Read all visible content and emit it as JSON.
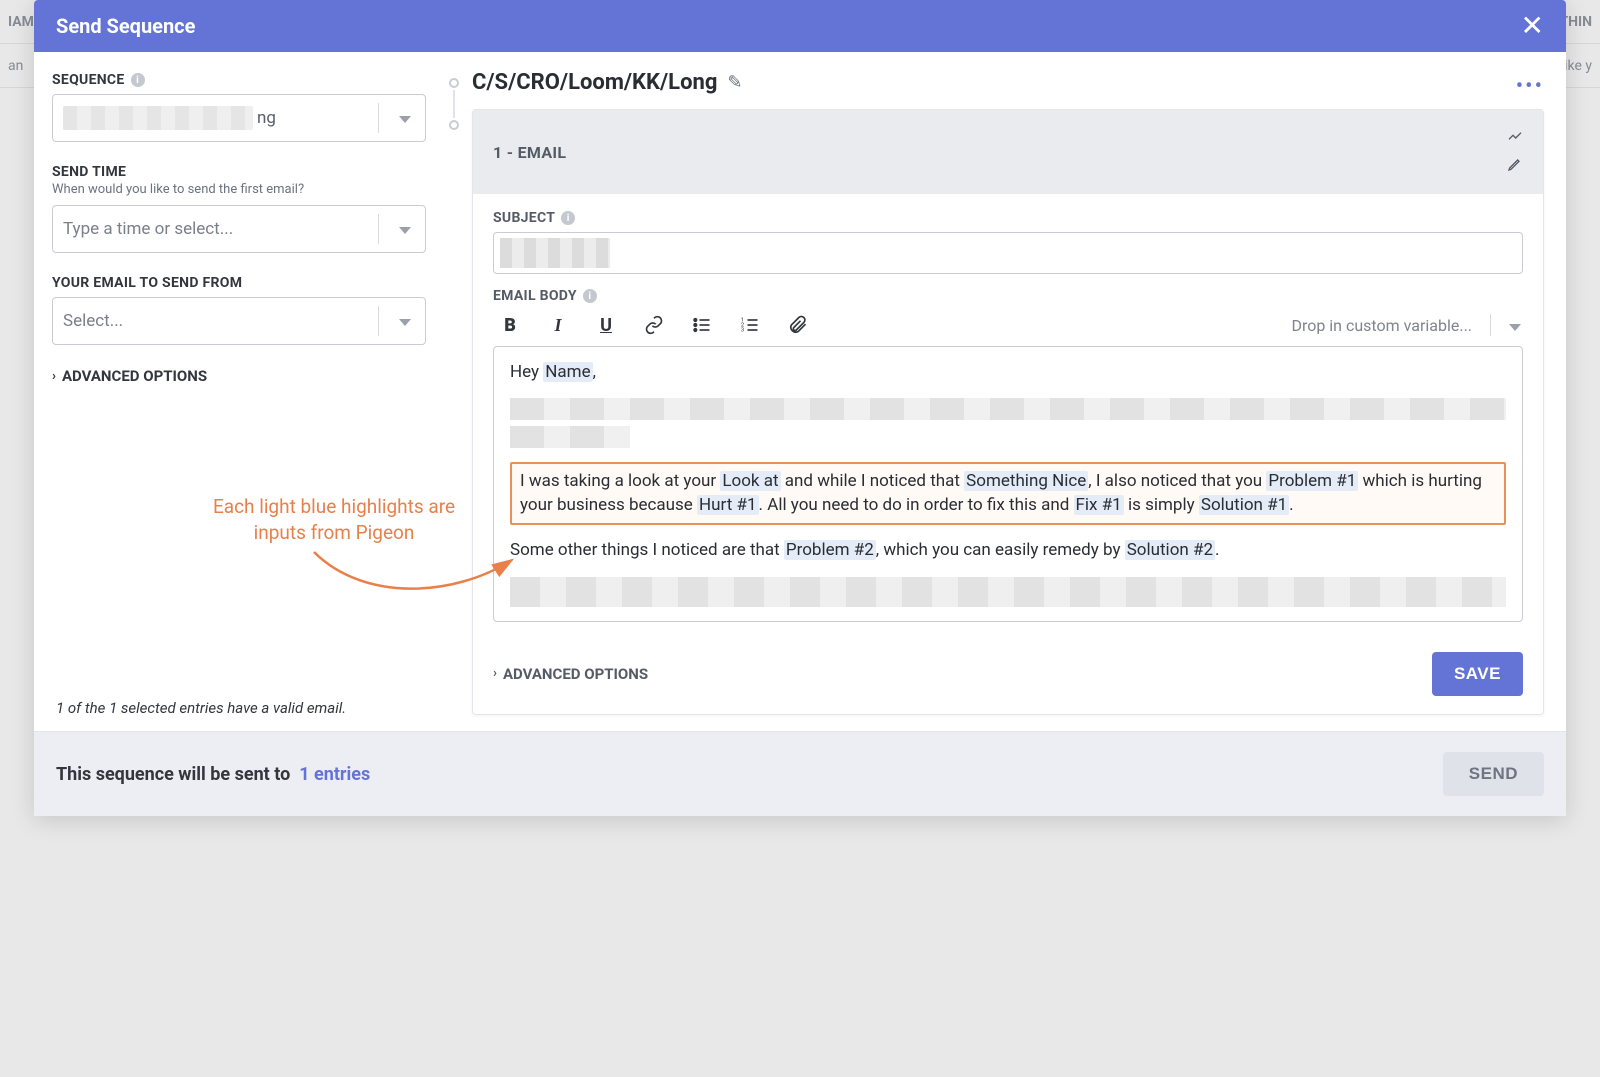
{
  "bg": {
    "col1": "IAME",
    "col2": "ETHIN",
    "row1_left": "an",
    "row1_right": "ike y"
  },
  "modal": {
    "title": "Send Sequence",
    "footer_prefix": "This sequence will be sent to",
    "footer_entries": "1 entries",
    "send": "SEND"
  },
  "left": {
    "sequence_label": "SEQUENCE",
    "sequence_value_suffix": "ng",
    "sendtime_label": "SEND TIME",
    "sendtime_sub": "When would you like to send the first email?",
    "sendtime_placeholder": "Type a time or select...",
    "from_label": "YOUR EMAIL TO SEND FROM",
    "from_placeholder": "Select...",
    "advanced": "ADVANCED OPTIONS",
    "valid_note": "1 of the 1 selected entries have a valid email."
  },
  "right": {
    "title": "C/S/CRO/Loom/KK/Long",
    "step_label": "1 - EMAIL",
    "subject_label": "SUBJECT",
    "body_label": "EMAIL BODY",
    "custom_var": "Drop in custom variable...",
    "advanced": "ADVANCED OPTIONS",
    "save": "SAVE"
  },
  "email_body": {
    "greeting_prefix": "Hey ",
    "greeting_var": "Name",
    "greeting_suffix": ",",
    "p2_1": "I was taking a look at your ",
    "v_lookat": "Look at",
    "p2_2": " and while I noticed that ",
    "v_nice": "Something Nice",
    "p2_3": ", I also noticed that you ",
    "v_prob1": "Problem #1",
    "p2_4": " which is hurting your business because ",
    "v_hurt1": "Hurt #1",
    "p2_5": ". All you need to do in order to fix this and ",
    "v_fix1": "Fix #1",
    "p2_6": " is simply ",
    "v_sol1": "Solution #1",
    "p2_7": ".",
    "p3_1": "Some other things I noticed are that ",
    "v_prob2": "Problem #2",
    "p3_2": ", which you can easily remedy by ",
    "v_sol2": "Solution #2",
    "p3_3": "."
  },
  "annotation": {
    "line1": "Each light blue highlights are",
    "line2": "inputs from Pigeon"
  }
}
